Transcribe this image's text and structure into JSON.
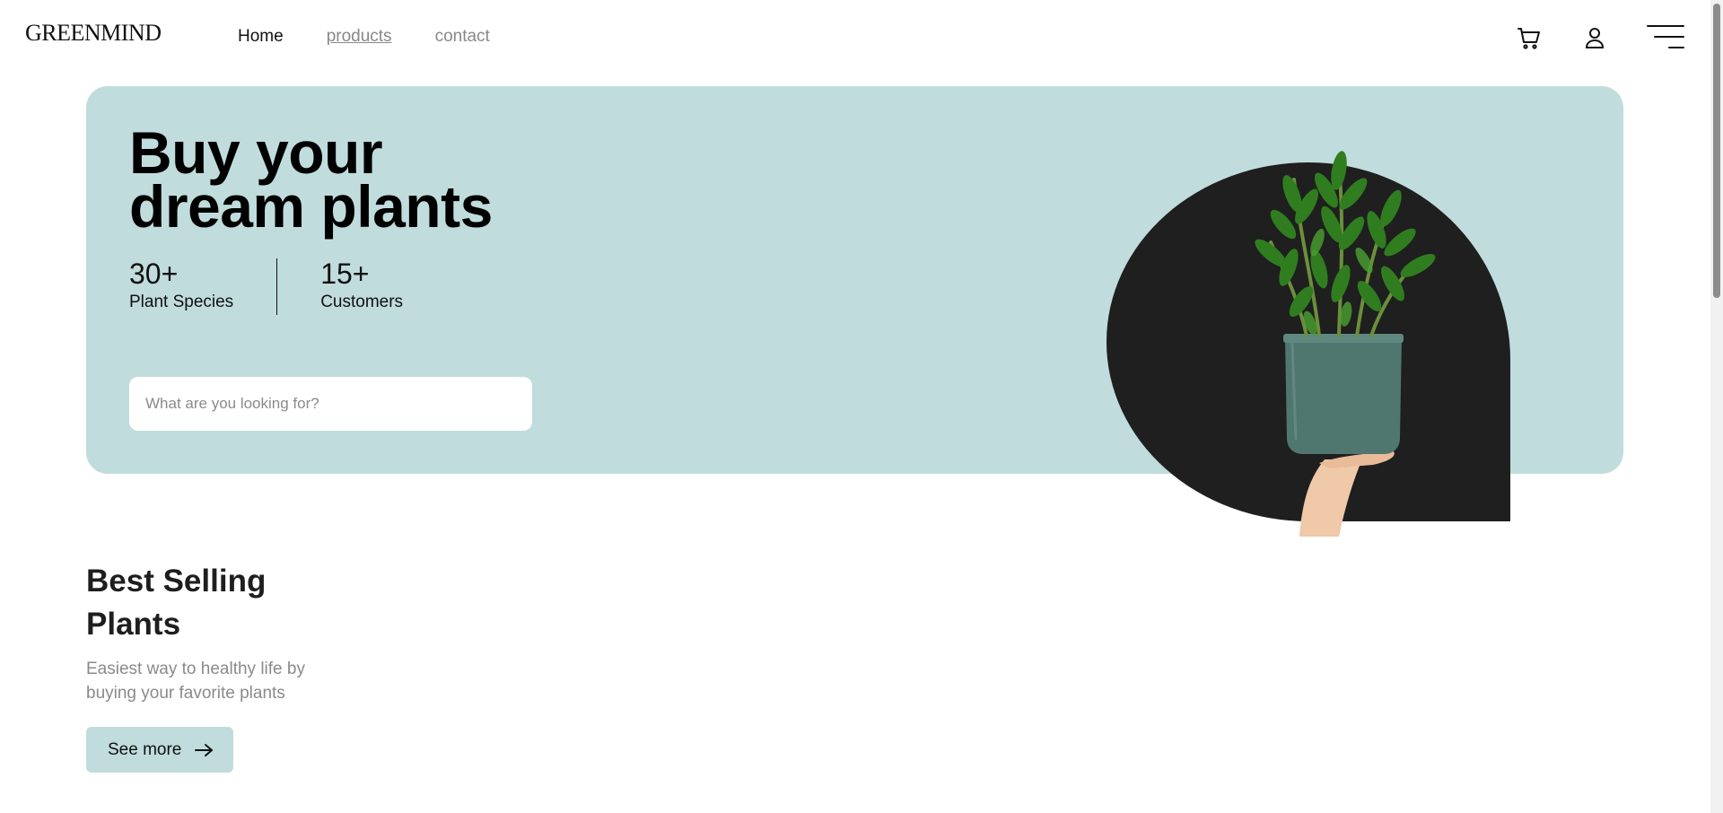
{
  "header": {
    "logo": "GREENMIND",
    "nav": [
      {
        "label": "Home"
      },
      {
        "label": "products"
      },
      {
        "label": "contact"
      }
    ],
    "icons": {
      "cart": "cart-icon",
      "user": "user-icon",
      "menu": "menu-icon"
    }
  },
  "hero": {
    "title_line1": "Buy your",
    "title_line2": "dream plants",
    "stats": [
      {
        "value": "30+",
        "label": "Plant Species"
      },
      {
        "value": "15+",
        "label": "Customers"
      }
    ],
    "search_placeholder": "What are you looking for?",
    "background_color": "#c1dcdc"
  },
  "best_selling": {
    "title_line1": "Best Selling",
    "title_line2": "Plants",
    "description": "Easiest way to healthy life by buying your favorite plants",
    "button_label": "See more"
  },
  "colors": {
    "accent": "#c1dcdc",
    "dark": "#1e1e1e",
    "muted": "#8a8a8a"
  }
}
